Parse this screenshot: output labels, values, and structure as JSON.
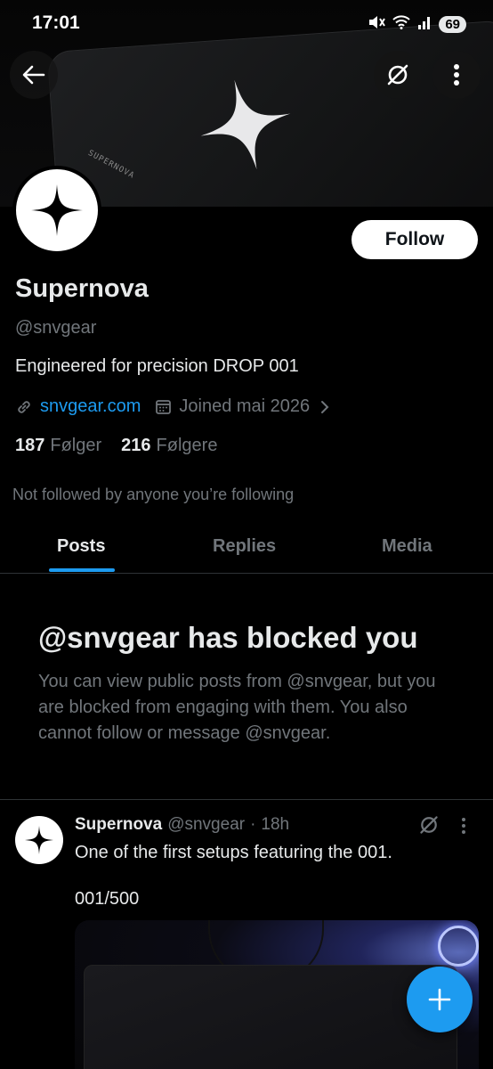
{
  "status_bar": {
    "time": "17:01",
    "battery": "69"
  },
  "profile": {
    "display_name": "Supernova",
    "handle": "@snvgear",
    "bio": "Engineered for precision DROP 001",
    "website": "snvgear.com",
    "joined": "Joined mai 2026",
    "following_count": "187",
    "following_label": "Følger",
    "followers_count": "216",
    "followers_label": "Følgere",
    "follow_button": "Follow",
    "social_context": "Not followed by anyone you’re following",
    "banner_pad_text": "SUPERNOVA"
  },
  "tabs": [
    {
      "label": "Posts",
      "active": true
    },
    {
      "label": "Replies",
      "active": false
    },
    {
      "label": "Media",
      "active": false
    }
  ],
  "blocked": {
    "title": "@snvgear has blocked you",
    "description": "You can view public posts from @snvgear, but you are blocked from engaging with them. You also cannot follow or message @snvgear."
  },
  "post": {
    "author_name": "Supernova",
    "author_handle": "@snvgear",
    "separator": "·",
    "time": "18h",
    "text": "One of the first setups featuring the 001.",
    "text2": "001/500"
  },
  "icons": {
    "back": "arrow-left-icon",
    "grok": "grok-icon",
    "more": "more-vertical-icon",
    "link": "link-icon",
    "calendar": "calendar-icon",
    "chevron": "chevron-right-icon",
    "compose": "plus-icon"
  },
  "colors": {
    "accent": "#1d9bf0",
    "background": "#000000",
    "text_primary": "#e7e9ea",
    "text_secondary": "#71767b"
  }
}
